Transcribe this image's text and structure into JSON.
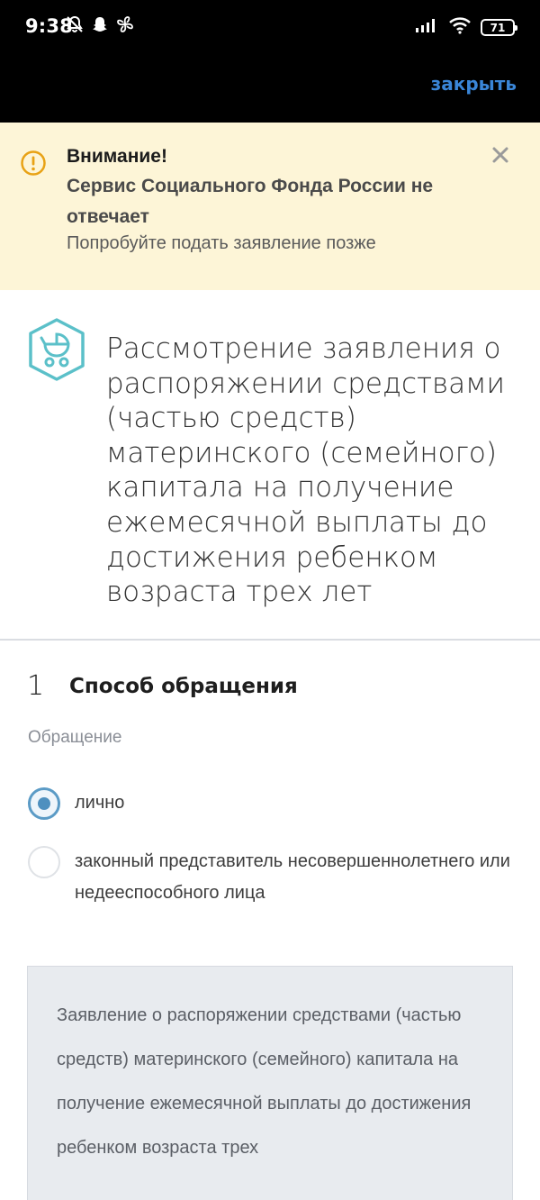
{
  "status_bar": {
    "time": "9:38",
    "battery": "71",
    "icons": [
      "notifications-off-icon",
      "snapchat-icon",
      "fan-icon",
      "signal-icon",
      "wifi-icon",
      "battery-icon"
    ]
  },
  "action_bar": {
    "close_label": "закрыть"
  },
  "alert": {
    "title": "Внимание!",
    "subtitle": "Сервис Социального Фонда России не отвечает",
    "text": "Попробуйте подать заявление позже",
    "background": "#fdf5d7",
    "icon_color": "#e8a215"
  },
  "service": {
    "icon": "baby-stroller-icon",
    "title": "Рассмотрение заявления о распоряжении средствами (частью средств) материнского (семейного) капитала на получение ежемесячной выплаты до достижения ребенком возраста трех лет"
  },
  "step": {
    "number": "1",
    "title": "Способ обращения"
  },
  "form": {
    "field_label": "Обращение",
    "options": [
      {
        "label": "лично",
        "selected": true
      },
      {
        "label": "законный представитель несовершеннолетнего или недееспособного лица",
        "selected": false
      }
    ]
  },
  "info": {
    "text": "Заявление о распоряжении средствами (частью средств) материнского (семейного) капитала на получение ежемесячной выплаты до достижения ребенком возраста трех"
  },
  "colors": {
    "link": "#3a86d8",
    "accent": "#4f90bf",
    "service_icon": "#5bc0c9"
  }
}
